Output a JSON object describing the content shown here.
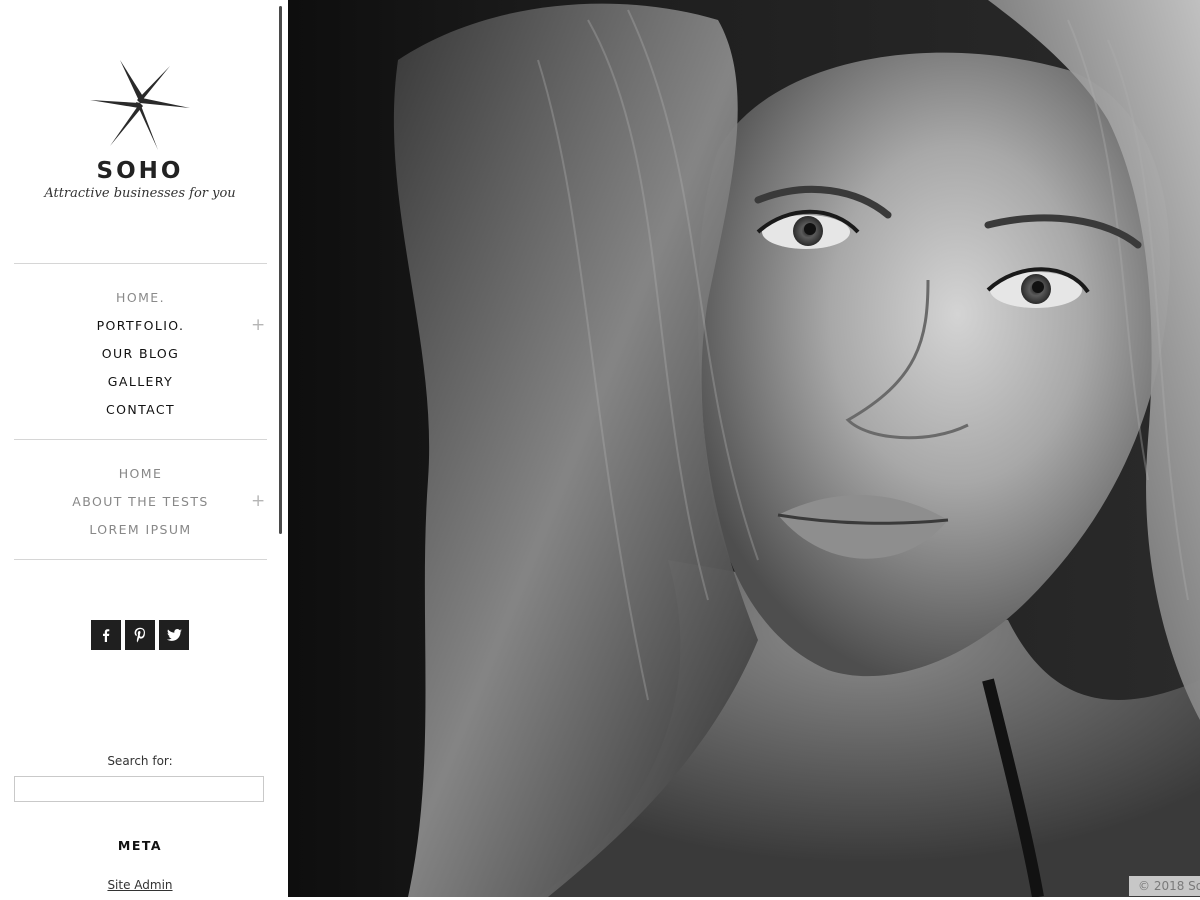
{
  "site": {
    "title": "SOHO",
    "tagline": "Attractive businesses for you",
    "logo_icon": "star-burst-logo"
  },
  "nav_main": [
    {
      "label": "HOME.",
      "current": true,
      "has_submenu": false
    },
    {
      "label": "PORTFOLIO.",
      "current": false,
      "has_submenu": true
    },
    {
      "label": "OUR BLOG",
      "current": false,
      "has_submenu": false
    },
    {
      "label": "GALLERY",
      "current": false,
      "has_submenu": false
    },
    {
      "label": "CONTACT",
      "current": false,
      "has_submenu": false
    }
  ],
  "nav_secondary": [
    {
      "label": "HOME",
      "has_submenu": false
    },
    {
      "label": "ABOUT THE TESTS",
      "has_submenu": true
    },
    {
      "label": "LOREM IPSUM",
      "has_submenu": false
    }
  ],
  "submenu_icon": "plus-icon",
  "submenu_symbol": "+",
  "social": [
    {
      "name": "facebook",
      "icon": "facebook-icon"
    },
    {
      "name": "pinterest",
      "icon": "pinterest-icon"
    },
    {
      "name": "twitter",
      "icon": "twitter-icon"
    }
  ],
  "search": {
    "label": "Search for:",
    "value": "",
    "placeholder": ""
  },
  "meta": {
    "heading": "META",
    "links": [
      "Site Admin"
    ]
  },
  "hero": {
    "image": "black-and-white-portrait-photo"
  },
  "footer": {
    "copyright": "© 2018 So"
  },
  "colors": {
    "text_dark": "#111111",
    "text_muted": "#888888",
    "social_bg": "#1f1f1f",
    "divider": "#d6d6d6"
  }
}
